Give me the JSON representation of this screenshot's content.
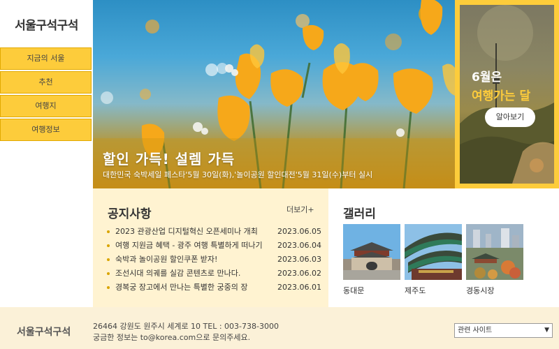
{
  "site": {
    "logo": "서울구석구석"
  },
  "nav": [
    {
      "label": "지금의 서울"
    },
    {
      "label": "추천"
    },
    {
      "label": "여행지"
    },
    {
      "label": "여행정보"
    }
  ],
  "hero": {
    "title": "할인 가득! 설렘 가득",
    "subtitle": "대한민국 숙박세일 페스타'5월 30일(화),'놀이공원 할인대전'5월 31일(수)부터 실시"
  },
  "promo": {
    "line1": "6월은",
    "line2": "여행가는 달",
    "button": "알아보기"
  },
  "notice": {
    "title": "공지사항",
    "more": "더보기+",
    "items": [
      {
        "text": "2023 관광산업 디지털혁신 오픈세미나 개최",
        "date": "2023.06.05"
      },
      {
        "text": "여행 지원금 혜택 - 광주 여행 특별하게 떠나기",
        "date": "2023.06.04"
      },
      {
        "text": "숙박과 놀이공원 할인쿠폰 받자!",
        "date": "2023.06.03"
      },
      {
        "text": "조선시대 의궤를 실감 콘텐츠로 만나다.",
        "date": "2023.06.02"
      },
      {
        "text": "경복궁 장고에서 만나는 특별한 궁중의 장",
        "date": "2023.06.01"
      }
    ]
  },
  "gallery": {
    "title": "갤러리",
    "items": [
      {
        "caption": "동대문"
      },
      {
        "caption": "제주도"
      },
      {
        "caption": "경동시장"
      }
    ]
  },
  "footer": {
    "logo": "서울구석구석",
    "address": "26464 강원도 원주시 세계로 10 TEL : 003-738-3000",
    "contact": "궁금한 정보는 to@korea.com으로 문의주세요.",
    "select_value": "관련 사이트"
  },
  "colors": {
    "accent": "#fdcc3b",
    "notice_bg": "#fff3d1",
    "footer_bg": "#fbf1d8"
  }
}
